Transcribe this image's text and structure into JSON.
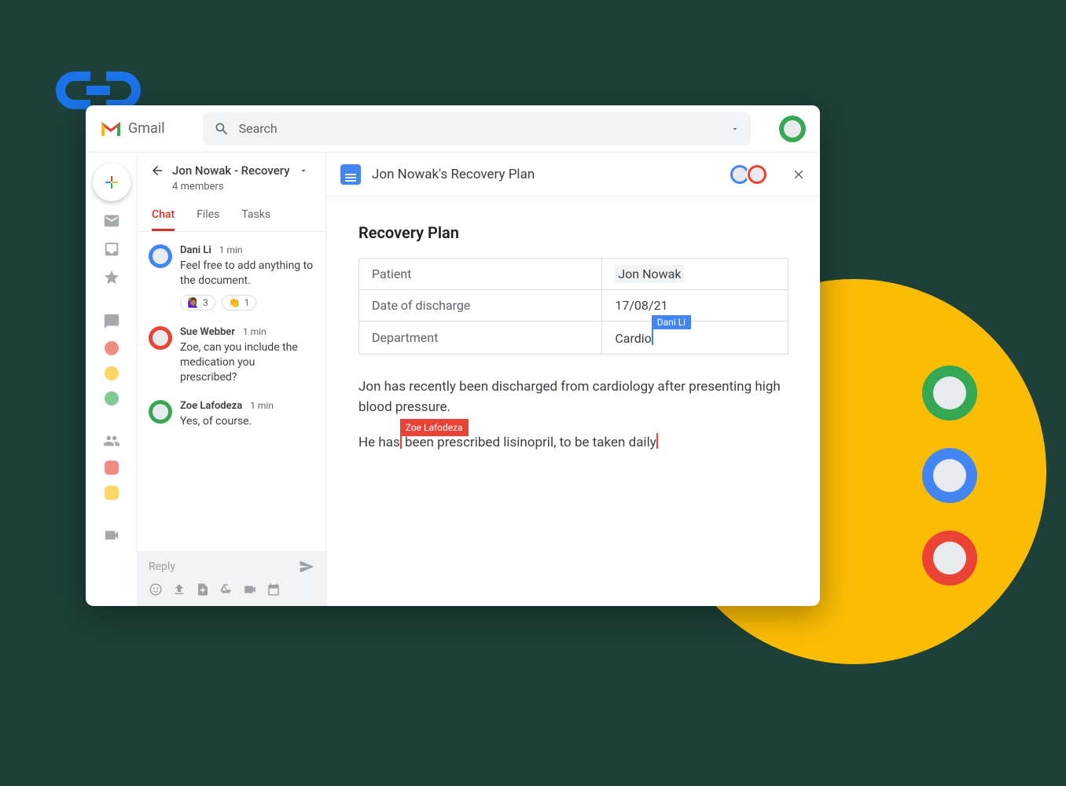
{
  "header": {
    "app_label": "Gmail",
    "search_placeholder": "Search"
  },
  "chat": {
    "title": "Jon Nowak - Recovery",
    "subtitle": "4 members",
    "tabs": [
      "Chat",
      "Files",
      "Tasks"
    ],
    "active_tab": "Chat",
    "messages": [
      {
        "author": "Dani Li",
        "time": "1 min",
        "text": "Feel free to add anything to the document.",
        "avatar_color": "#4285f4",
        "reactions": [
          {
            "emoji": "🙋🏽‍♀️",
            "count": "3"
          },
          {
            "emoji": "👏",
            "count": "1"
          }
        ]
      },
      {
        "author": "Sue Webber",
        "time": "1 min",
        "text": "Zoe, can you include the medication you prescribed?",
        "avatar_color": "#ea4335",
        "reactions": []
      },
      {
        "author": "Zoe Lafodeza",
        "time": "1 min",
        "text": "Yes, of course.",
        "avatar_color": "#34a853",
        "reactions": []
      }
    ],
    "composer": {
      "placeholder": "Reply"
    }
  },
  "doc": {
    "title": "Jon Nowak's Recovery Plan",
    "heading": "Recovery Plan",
    "table": [
      {
        "label": "Patient",
        "value": "Jon Nowak",
        "highlight": true
      },
      {
        "label": "Date of discharge",
        "value": "17/08/21"
      },
      {
        "label": "Department",
        "value": "Cardio",
        "cursor": {
          "name": "Dani Li",
          "color": "blue"
        }
      }
    ],
    "paragraphs": [
      "Jon has recently been discharged from cardiology after presenting high blood pressure.",
      "He has been prescribed lisinopril, to be taken daily"
    ],
    "para_cursor": {
      "name": "Zoe Lafodeza",
      "after_word": "has",
      "para_index": 1
    },
    "collaborators": [
      {
        "color": "#4285f4"
      },
      {
        "color": "#ea4335"
      }
    ]
  },
  "profile_avatar_color": "#34a853",
  "decor_avatars": [
    {
      "color": "#34a853"
    },
    {
      "color": "#4285f4"
    },
    {
      "color": "#ea4335"
    }
  ]
}
